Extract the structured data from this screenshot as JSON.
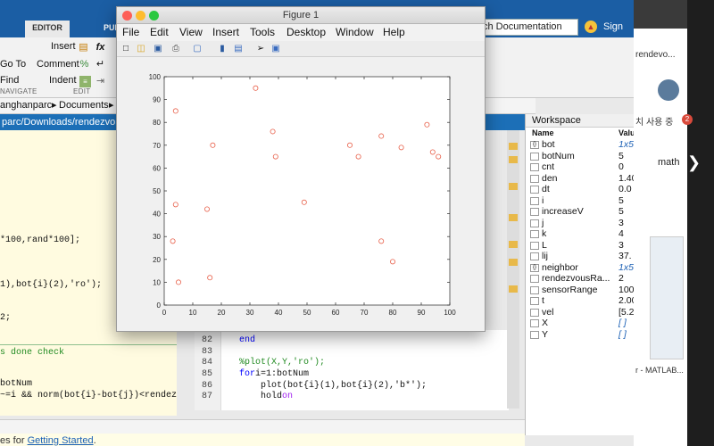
{
  "matlab": {
    "ribbon_tabs": [
      "EDITOR",
      "PUB"
    ],
    "search_placeholder": "ch Documentation",
    "signin": "Sign In",
    "ribbon": {
      "insert": "Insert",
      "comment": "Comment",
      "indent": "Indent",
      "goto": "Go To",
      "find": "Find",
      "groups": [
        "NAVIGATE",
        "EDIT"
      ]
    },
    "path": {
      "user": "anghanparc",
      "documents": "Documents",
      "full": "parc/Downloads/rendezvo"
    },
    "editor_left": [
      "*100,rand*100];",
      "1),bot{i}(2),'ro');",
      "2;",
      "s done check",
      "botNum",
      "~=i && norm(bot{i}-bot{j})<rendez"
    ],
    "editor_lines": [
      {
        "num": "82",
        "code": "end"
      },
      {
        "num": "83",
        "code": ""
      },
      {
        "num": "84",
        "code": "%plot(X,Y,'ro');"
      },
      {
        "num": "85",
        "kw": "for",
        "code": " i=1:botNum"
      },
      {
        "num": "86",
        "code": "plot(bot{i}(1),bot{i}(2),'b*');"
      },
      {
        "num": "87",
        "code": "hold",
        "bl": " on"
      }
    ],
    "cmd_prefix": "es for ",
    "cmd_link": "Getting Started",
    "cmd_suffix": "."
  },
  "workspace": {
    "title": "Workspace",
    "col_name": "Name",
    "col_value": "Valu",
    "rows": [
      {
        "name": "bot",
        "value": "1x5",
        "icon": "cell",
        "italic": true
      },
      {
        "name": "botNum",
        "value": "5"
      },
      {
        "name": "cnt",
        "value": "0"
      },
      {
        "name": "den",
        "value": "1.40"
      },
      {
        "name": "dt",
        "value": "0.0"
      },
      {
        "name": "i",
        "value": "5"
      },
      {
        "name": "increaseV",
        "value": "5"
      },
      {
        "name": "j",
        "value": "3"
      },
      {
        "name": "k",
        "value": "4"
      },
      {
        "name": "L",
        "value": "3"
      },
      {
        "name": "lij",
        "value": "37."
      },
      {
        "name": "neighbor",
        "value": "1x5",
        "icon": "cell",
        "italic": true
      },
      {
        "name": "rendezvousRa...",
        "value": "2"
      },
      {
        "name": "sensorRange",
        "value": "100"
      },
      {
        "name": "t",
        "value": "2.00"
      },
      {
        "name": "vel",
        "value": "[5.2"
      },
      {
        "name": "X",
        "value": "[ ]",
        "italic": true
      },
      {
        "name": "Y",
        "value": "[ ]",
        "italic": true
      }
    ]
  },
  "browser": {
    "snippets": [
      "rendevo...",
      "치 사용 중",
      "math",
      "r - MATLAB..."
    ],
    "badge": "2"
  },
  "figure": {
    "title": "Figure 1",
    "menu": [
      "File",
      "Edit",
      "View",
      "Insert",
      "Tools",
      "Desktop",
      "Window",
      "Help"
    ]
  },
  "chart_data": {
    "type": "scatter",
    "title": "",
    "xlabel": "",
    "ylabel": "",
    "xlim": [
      0,
      100
    ],
    "ylim": [
      0,
      100
    ],
    "xticks": [
      0,
      10,
      20,
      30,
      40,
      50,
      60,
      70,
      80,
      90,
      100
    ],
    "yticks": [
      0,
      10,
      20,
      30,
      40,
      50,
      60,
      70,
      80,
      90,
      100
    ],
    "marker": "o",
    "marker_color": "#e8604a",
    "grid": false,
    "x": [
      3,
      4,
      4,
      5,
      15,
      16,
      17,
      32,
      38,
      39,
      49,
      65,
      68,
      76,
      76,
      80,
      83,
      92,
      94,
      96
    ],
    "y": [
      28,
      85,
      44,
      10,
      42,
      12,
      70,
      95,
      76,
      65,
      45,
      70,
      65,
      74,
      28,
      19,
      69,
      79,
      67,
      65
    ]
  }
}
